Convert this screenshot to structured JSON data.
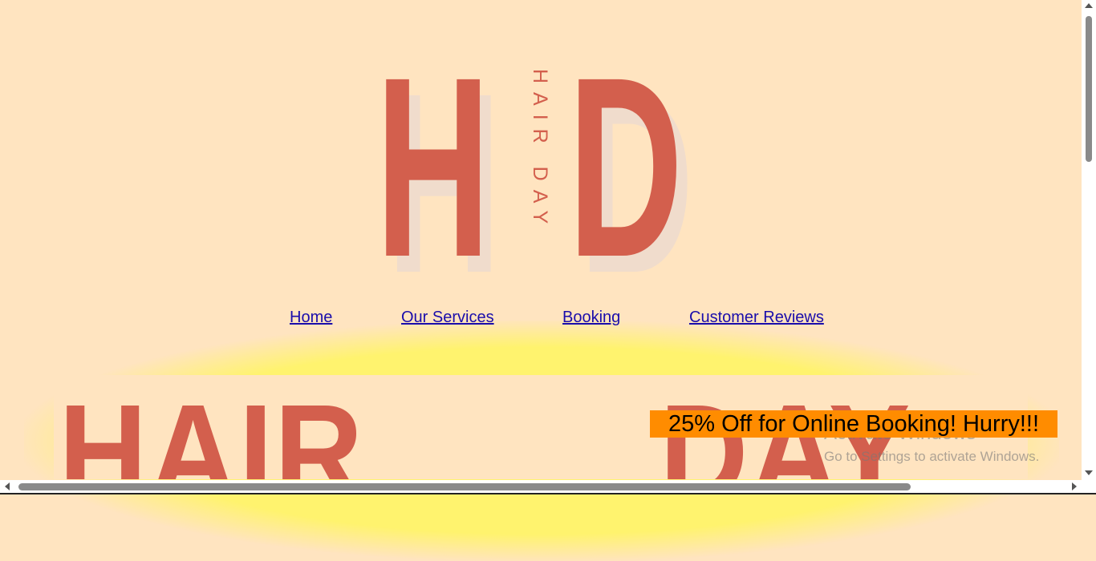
{
  "logo": {
    "letter_left": "H",
    "letter_right": "D",
    "vertical_text": "HAIR DAY",
    "color": "#d35f4d"
  },
  "nav": {
    "items": [
      {
        "label": "Home"
      },
      {
        "label": "Our Services"
      },
      {
        "label": "Booking"
      },
      {
        "label": "Customer Reviews"
      }
    ]
  },
  "hero": {
    "word_left": "HAIR",
    "word_right": "DAY"
  },
  "promo": {
    "text": "25% Off for Online Booking! Hurry!!!",
    "background": "#ff8c00"
  },
  "watermark": {
    "title": "Activate Windows",
    "subtitle": "Go to Settings to activate Windows."
  },
  "colors": {
    "page_background": "#ffe4c0",
    "glow": "#fff36e",
    "link": "#1a0dab"
  }
}
